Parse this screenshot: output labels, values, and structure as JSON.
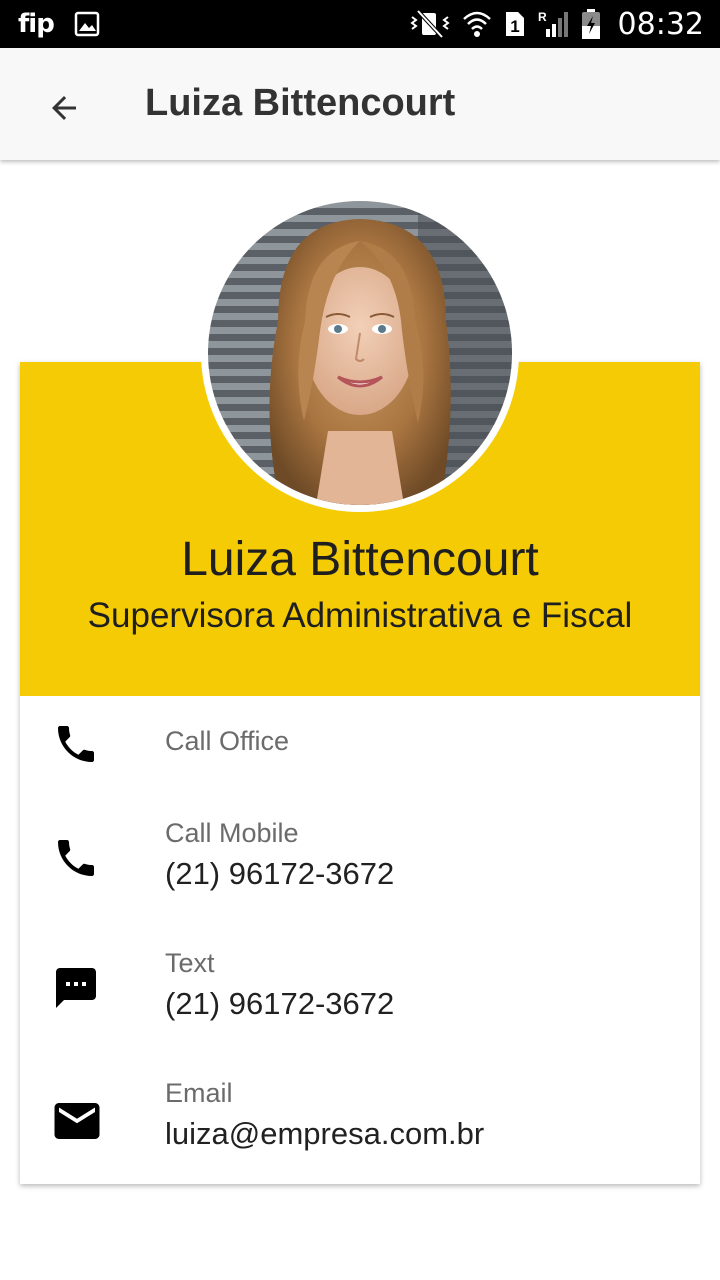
{
  "status_bar": {
    "carrier": "fip",
    "time": "08:32",
    "sim_slot": "1",
    "roaming": "R"
  },
  "app_bar": {
    "title": "Luiza Bittencourt"
  },
  "profile": {
    "name": "Luiza Bittencourt",
    "role": "Supervisora Administrativa e Fiscal"
  },
  "contacts": [
    {
      "icon": "phone-icon",
      "label": "Call Office",
      "value": ""
    },
    {
      "icon": "phone-icon",
      "label": "Call Mobile",
      "value": "(21) 96172-3672"
    },
    {
      "icon": "message-icon",
      "label": "Text",
      "value": "(21) 96172-3672"
    },
    {
      "icon": "email-icon",
      "label": "Email",
      "value": "luiza@empresa.com.br"
    }
  ],
  "colors": {
    "header_accent": "#f5cb05",
    "app_bar": "#f8f8f8",
    "status_bar": "#000000"
  }
}
